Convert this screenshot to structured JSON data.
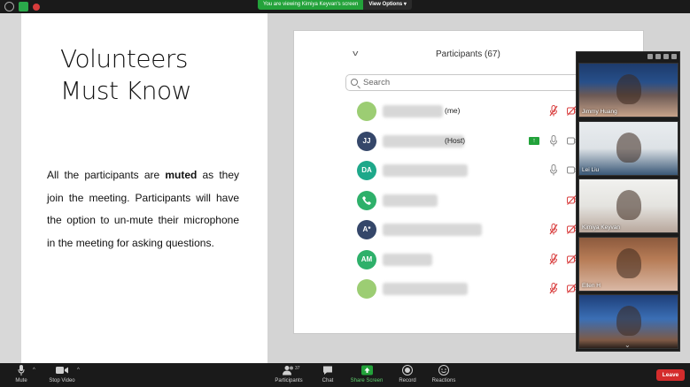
{
  "banner": {
    "text": "You are viewing Kimiya Keyvan's screen",
    "view_options": "View Options"
  },
  "slide": {
    "title_line1": "Volunteers",
    "title_line2": "Must Know",
    "body_pre": "All the participants are ",
    "body_bold": "muted",
    "body_post": " as they join the meeting. Participants will have the option to un-mute their microphone in the meeting for asking questions."
  },
  "panel": {
    "title": "Participants (67)",
    "search_placeholder": "Search",
    "rows": [
      {
        "initials": "",
        "color": "#9ccd73",
        "tag": "(me)",
        "mic": "muted",
        "cam": "off"
      },
      {
        "initials": "JJ",
        "color": "#35476a",
        "tag": "(Host)",
        "mic": "on",
        "cam": "on",
        "sharing": true
      },
      {
        "initials": "DA",
        "color": "#1ea88a",
        "tag": "",
        "mic": "on",
        "cam": "on"
      },
      {
        "initials": "",
        "color": "#2eb06a",
        "tag": "",
        "mic": "none",
        "cam": "off"
      },
      {
        "initials": "A*",
        "color": "#35476a",
        "tag": "",
        "mic": "muted",
        "cam": "off"
      },
      {
        "initials": "AM",
        "color": "#2eb06a",
        "tag": "",
        "mic": "muted",
        "cam": "off"
      },
      {
        "initials": "",
        "color": "#9ccd73",
        "tag": "",
        "mic": "muted",
        "cam": "off"
      }
    ]
  },
  "videos": [
    {
      "name": "Jimmy Huang"
    },
    {
      "name": "Lei Liu"
    },
    {
      "name": "Kimiya Keyvan"
    },
    {
      "name": "Ellen H"
    },
    {
      "name": ""
    }
  ],
  "toolbar": {
    "mute": "Mute",
    "stop_video": "Stop Video",
    "participants": "Participants",
    "participants_count": "37",
    "chat": "Chat",
    "share_screen": "Share Screen",
    "record": "Record",
    "reactions": "Reactions",
    "leave": "Leave"
  },
  "colors": {
    "share_green": "#23a23a",
    "leave_red": "#d42c2c",
    "muted_red": "#d94040"
  }
}
